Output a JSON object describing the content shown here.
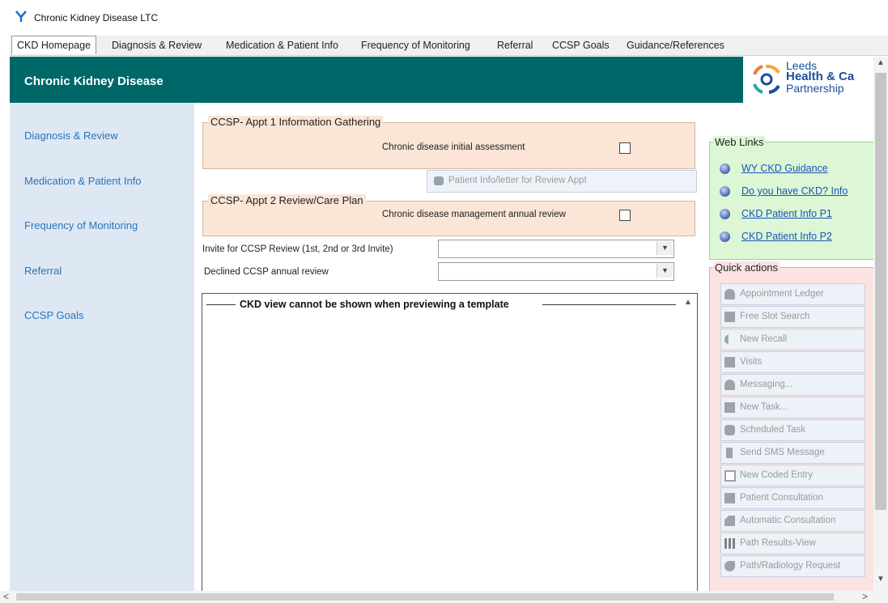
{
  "window": {
    "title": "Chronic Kidney Disease LTC"
  },
  "tabs": [
    {
      "label": "CKD Homepage"
    },
    {
      "label": "Diagnosis & Review"
    },
    {
      "label": "Medication & Patient Info"
    },
    {
      "label": "Frequency of Monitoring"
    },
    {
      "label": "Referral"
    },
    {
      "label": "CCSP Goals"
    },
    {
      "label": "Guidance/References"
    }
  ],
  "header": {
    "title": "Chronic Kidney Disease",
    "logo": {
      "line1": "Leeds",
      "line2": "Health & Ca",
      "line3": "Partnership"
    }
  },
  "left_nav": [
    {
      "label": "Diagnosis & Review"
    },
    {
      "label": "Medication & Patient Info"
    },
    {
      "label": "Frequency of Monitoring"
    },
    {
      "label": "Referral"
    },
    {
      "label": "CCSP Goals"
    }
  ],
  "appt1": {
    "legend": "CCSP- Appt 1 Information Gathering",
    "checkbox_label": "Chronic disease initial assessment",
    "checked": false
  },
  "info_button": {
    "label": "Patient Info/letter for Review Appt"
  },
  "appt2": {
    "legend": "CCSP- Appt 2 Review/Care Plan",
    "checkbox_label": "Chronic disease management annual review",
    "checked": false
  },
  "fields": [
    {
      "label": "Invite for CCSP Review (1st, 2nd or 3rd Invite)",
      "value": ""
    },
    {
      "label": "Declined CCSP annual review",
      "value": ""
    }
  ],
  "ckd_view": {
    "message": "CKD view cannot be shown when previewing a template"
  },
  "web_links": {
    "title": "Web Links",
    "items": [
      {
        "label": "WY CKD Guidance "
      },
      {
        "label": "Do you have CKD? Info"
      },
      {
        "label": "CKD Patient Info P1"
      },
      {
        "label": "CKD Patient Info P2"
      }
    ]
  },
  "quick_actions": {
    "title": "Quick actions",
    "items": [
      {
        "label": "Appointment Ledger",
        "icon": "appointment-ledger-icon"
      },
      {
        "label": "Free Slot Search",
        "icon": "calendar-icon"
      },
      {
        "label": "New Recall",
        "icon": "megaphone-icon"
      },
      {
        "label": "Visits",
        "icon": "visits-icon"
      },
      {
        "label": "Messaging...",
        "icon": "person-icon"
      },
      {
        "label": "New Task...",
        "icon": "task-icon"
      },
      {
        "label": "Scheduled Task",
        "icon": "scheduled-task-icon"
      },
      {
        "label": "Send SMS Message",
        "icon": "phone-icon"
      },
      {
        "label": "New Coded Entry",
        "icon": "coded-entry-icon"
      },
      {
        "label": "Patient Consultation",
        "icon": "consultation-icon"
      },
      {
        "label": "Automatic Consultation",
        "icon": "auto-consultation-icon"
      },
      {
        "label": "Path Results-View",
        "icon": "results-icon"
      },
      {
        "label": "Path/Radiology Request",
        "icon": "request-icon"
      }
    ]
  },
  "colors": {
    "header": "#006769",
    "left_nav_bg": "#dee8f4",
    "ccsp_panel": "#fbe5d6",
    "web_links_bg": "#dcf6d6",
    "quick_actions_bg": "#fbe3e3",
    "link": "#2a73b7"
  }
}
